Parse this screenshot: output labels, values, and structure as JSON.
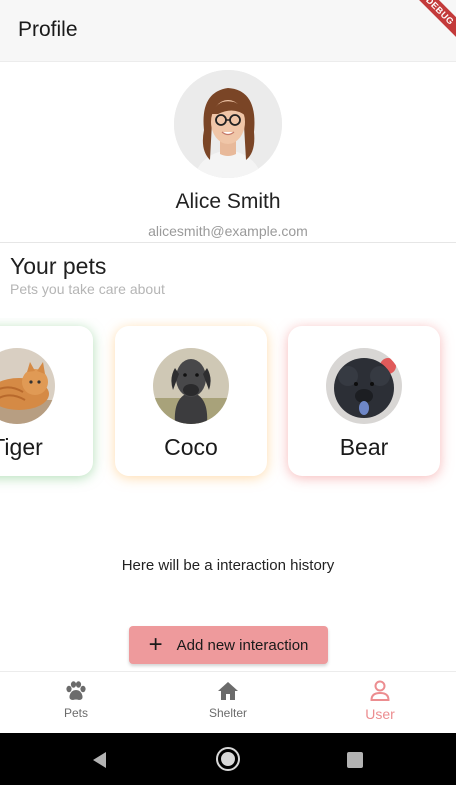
{
  "app_bar": {
    "title": "Profile",
    "debug_label": "DEBUG"
  },
  "profile": {
    "name": "Alice Smith",
    "email": "alicesmith@example.com"
  },
  "pets_section": {
    "title": "Your pets",
    "subtitle": "Pets you take care about",
    "pets": [
      {
        "name": "Tiger",
        "accent": "#76c47e",
        "icon": "cat-photo"
      },
      {
        "name": "Coco",
        "accent": "#ffc478",
        "icon": "dog-photo"
      },
      {
        "name": "Bear",
        "accent": "#f08282",
        "icon": "dog-photo"
      }
    ]
  },
  "history": {
    "text": "Here will be a interaction history"
  },
  "add_button": {
    "label": "Add new interaction",
    "icon": "plus-icon",
    "color": "#ee9a9c"
  },
  "bottom_nav": {
    "items": [
      {
        "label": "Pets",
        "icon": "paw-icon",
        "active": false
      },
      {
        "label": "Shelter",
        "icon": "home-icon",
        "active": false
      },
      {
        "label": "User",
        "icon": "user-icon",
        "active": true
      }
    ],
    "active_color": "#ec8d90"
  },
  "system_nav": {
    "buttons": [
      "back-icon",
      "home-circle-icon",
      "recents-icon"
    ]
  }
}
